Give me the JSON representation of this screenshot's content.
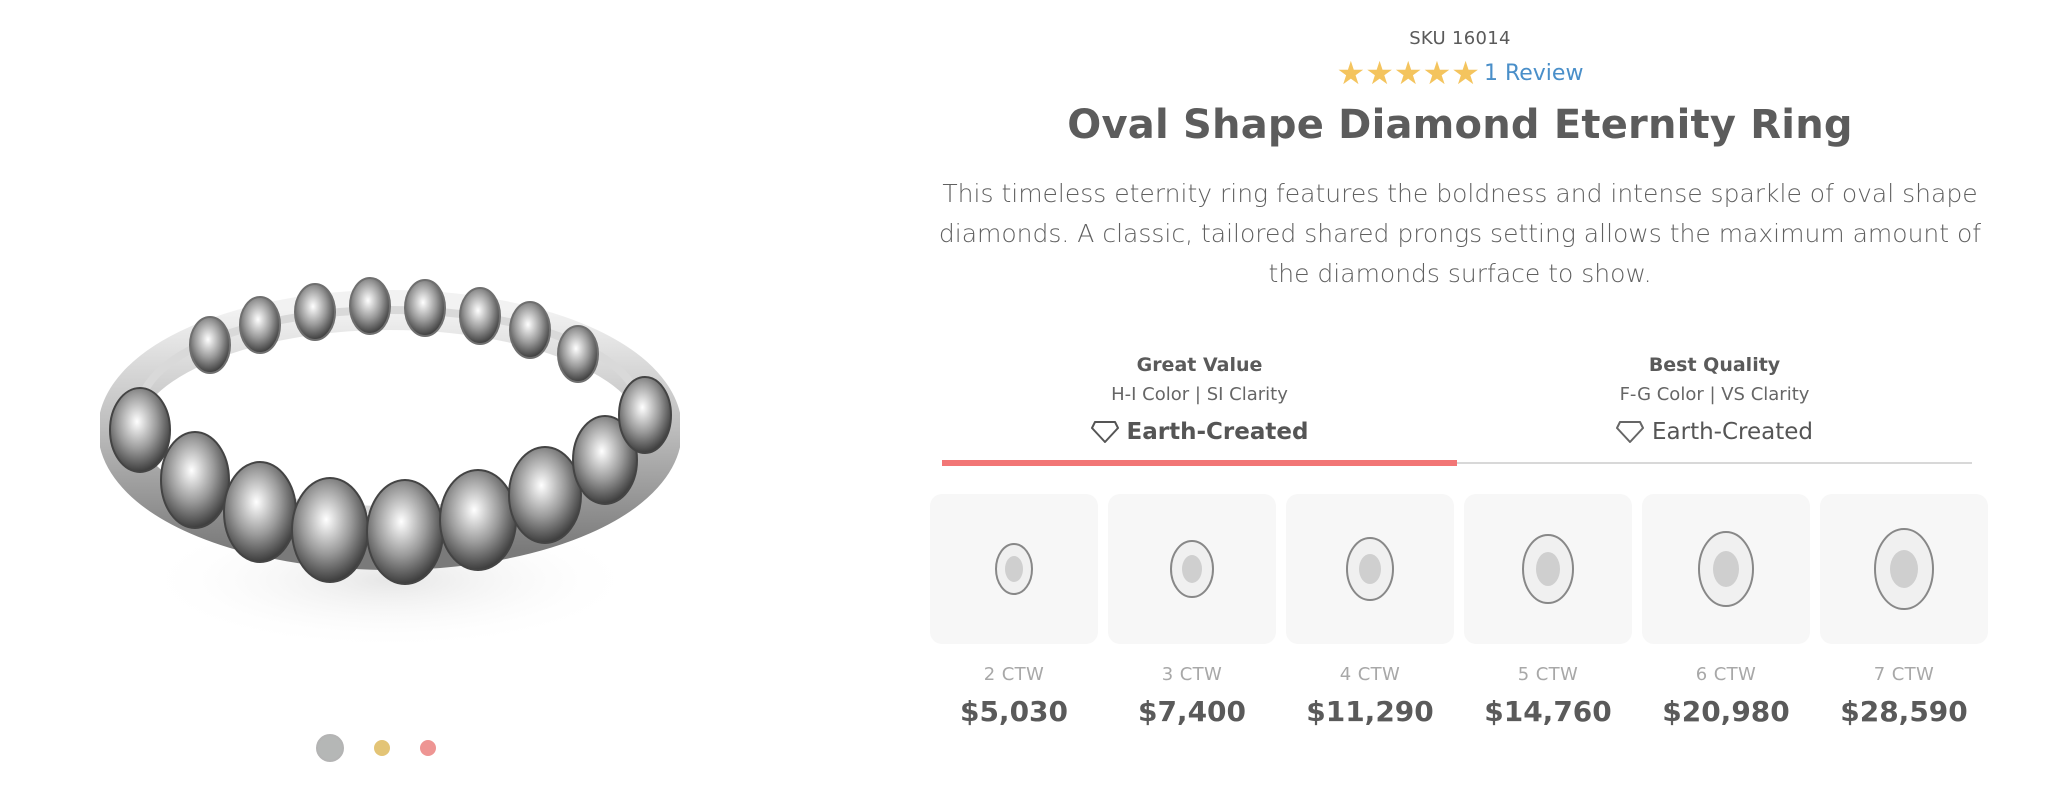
{
  "product": {
    "sku": "SKU 16014",
    "rating": 5,
    "reviews_label": "1 Review",
    "title": "Oval Shape Diamond Eternity Ring",
    "description": "This timeless eternity ring features the boldness and intense sparkle of oval shape diamonds. A classic, tailored shared prongs setting allows the maximum amount of the diamonds surface to show."
  },
  "gallery": {
    "image": "ring-image",
    "metal_swatches": [
      {
        "name": "white-gold",
        "color": "#b5b7b6",
        "selected": true
      },
      {
        "name": "yellow-gold",
        "color": "#e3c476",
        "selected": false
      },
      {
        "name": "rose-gold",
        "color": "#ee9593",
        "selected": false
      }
    ]
  },
  "quality_tabs": [
    {
      "title": "Great Value",
      "subtitle": "H-I Color | SI Clarity",
      "origin": "Earth-Created",
      "icon": "diamond-outline-icon",
      "active": true
    },
    {
      "title": "Best Quality",
      "subtitle": "F-G Color | VS Clarity",
      "origin": "Earth-Created",
      "icon": "diamond-outline-icon",
      "active": false
    }
  ],
  "carat_options": [
    {
      "label": "2 CTW",
      "price": "$5,030"
    },
    {
      "label": "3 CTW",
      "price": "$7,400"
    },
    {
      "label": "4 CTW",
      "price": "$11,290"
    },
    {
      "label": "5 CTW",
      "price": "$14,760"
    },
    {
      "label": "6 CTW",
      "price": "$20,980"
    },
    {
      "label": "7 CTW",
      "price": "$28,590"
    }
  ],
  "colors": {
    "star": "#f4c45e",
    "link": "#4a8fc9",
    "active_tab": "#f27676"
  }
}
